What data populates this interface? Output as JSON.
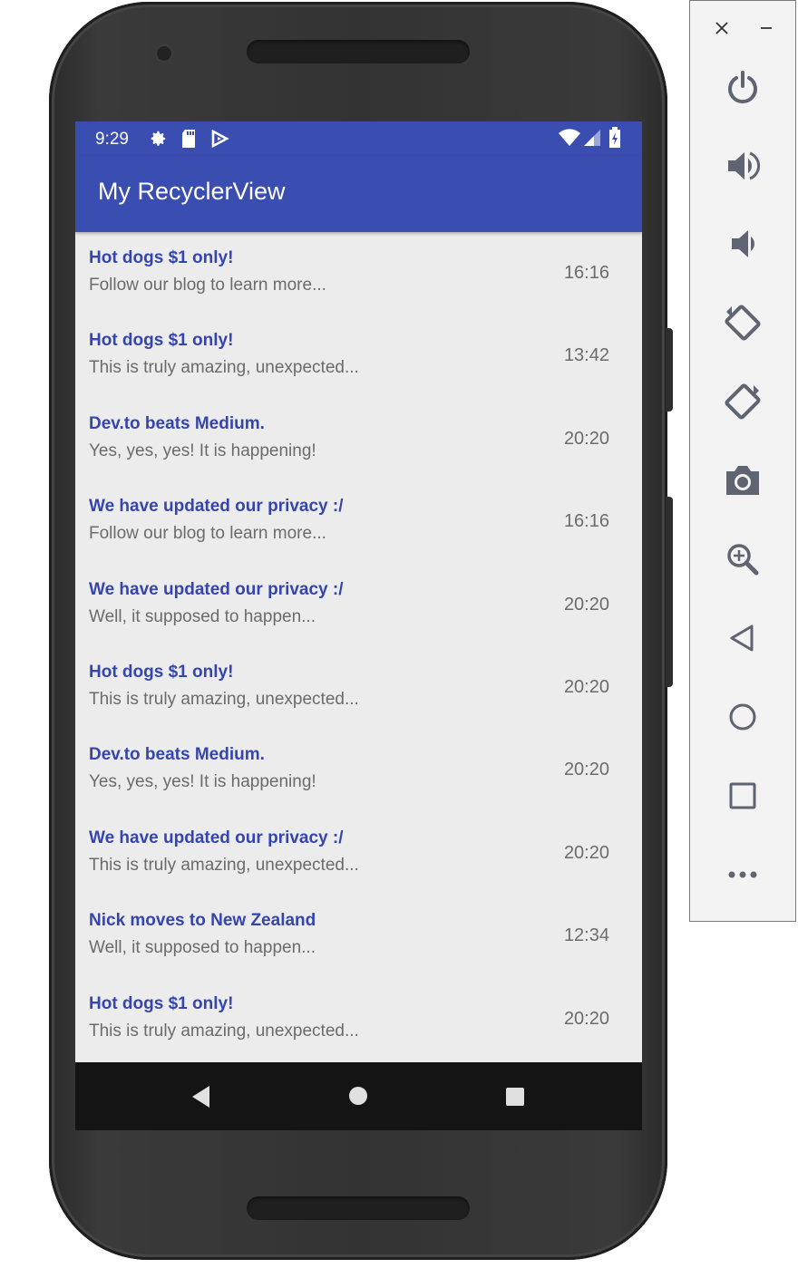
{
  "status_bar": {
    "time": "9:29",
    "left_icons": [
      "settings-icon",
      "sd-card-icon",
      "play-store-icon"
    ],
    "right_icons": [
      "wifi-icon",
      "cell-signal-icon",
      "battery-icon"
    ]
  },
  "app_bar": {
    "title": "My RecyclerView"
  },
  "messages": [
    {
      "title": "Hot dogs $1 only!",
      "subtitle": "Follow our blog to learn more...",
      "time": "16:16"
    },
    {
      "title": "Hot dogs $1 only!",
      "subtitle": "This is truly amazing, unexpected...",
      "time": "13:42"
    },
    {
      "title": "Dev.to beats Medium.",
      "subtitle": "Yes, yes, yes! It is happening!",
      "time": "20:20"
    },
    {
      "title": "We have updated our privacy :/",
      "subtitle": "Follow our blog to learn more...",
      "time": "16:16"
    },
    {
      "title": "We have updated our privacy :/",
      "subtitle": "Well, it supposed to happen...",
      "time": "20:20"
    },
    {
      "title": "Hot dogs $1 only!",
      "subtitle": "This is truly amazing, unexpected...",
      "time": "20:20"
    },
    {
      "title": "Dev.to beats Medium.",
      "subtitle": "Yes, yes, yes! It is happening!",
      "time": "20:20"
    },
    {
      "title": "We have updated our privacy :/",
      "subtitle": "This is truly amazing, unexpected...",
      "time": "20:20"
    },
    {
      "title": "Nick moves to New Zealand",
      "subtitle": "Well, it supposed to happen...",
      "time": "12:34"
    },
    {
      "title": "Hot dogs $1 only!",
      "subtitle": "This is truly amazing, unexpected...",
      "time": "20:20"
    }
  ],
  "nav_bar": [
    "back-icon",
    "home-icon",
    "recents-icon"
  ],
  "emulator_panel": {
    "window_controls": [
      "close-icon",
      "minimize-icon"
    ],
    "tools": [
      "power-icon",
      "volume-up-icon",
      "volume-down-icon",
      "rotate-left-icon",
      "rotate-right-icon",
      "camera-icon",
      "zoom-icon",
      "back-icon",
      "home-icon",
      "overview-icon",
      "more-icon"
    ]
  },
  "colors": {
    "primary": "#3a4db0",
    "title_text": "#3445b0",
    "secondary_text": "#6b6b6b",
    "list_background": "#ececec"
  }
}
